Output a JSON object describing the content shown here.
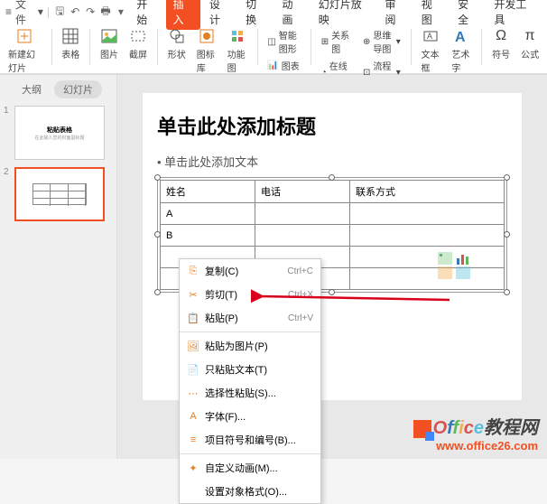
{
  "menu": {
    "file": "文件",
    "tabs": [
      "开始",
      "插入",
      "设计",
      "切换",
      "动画",
      "幻灯片放映",
      "审阅",
      "视图",
      "安全",
      "开发工具"
    ],
    "active_tab": "插入"
  },
  "ribbon": {
    "new_slide": "新建幻灯片",
    "table": "表格",
    "image": "图片",
    "screenshot": "截屏",
    "shapes": "形状",
    "icons": "图标库",
    "functions": "功能图",
    "smart_art": "智能图形",
    "chart": "图表",
    "relation": "关系图",
    "online_chart": "在线图表",
    "mindmap": "思维导图",
    "flowchart": "流程图",
    "textbox": "文本框",
    "wordart": "艺术字",
    "symbol": "符号",
    "equation": "公式"
  },
  "side": {
    "outline": "大纲",
    "slides": "幻灯片",
    "thumb1_title": "粘贴表格",
    "thumb1_sub": "在此输入您的封面副标题",
    "thumbs": [
      "1",
      "2"
    ]
  },
  "slide": {
    "title": "单击此处添加标题",
    "bullet": "单击此处添加文本",
    "headers": [
      "姓名",
      "电话",
      "联系方式"
    ],
    "rows": [
      [
        "A",
        "",
        ""
      ],
      [
        "B",
        "",
        ""
      ]
    ]
  },
  "context_menu": [
    {
      "icon": "⎘",
      "label": "复制(C)",
      "shortcut": "Ctrl+C"
    },
    {
      "icon": "✂",
      "label": "剪切(T)",
      "shortcut": "Ctrl+X"
    },
    {
      "icon": "📋",
      "label": "粘贴(P)",
      "shortcut": "Ctrl+V"
    },
    {
      "sep": true
    },
    {
      "icon": "🖼",
      "label": "粘贴为图片(P)",
      "shortcut": ""
    },
    {
      "icon": "📄",
      "label": "只粘贴文本(T)",
      "shortcut": ""
    },
    {
      "icon": "⋯",
      "label": "选择性粘贴(S)...",
      "shortcut": ""
    },
    {
      "icon": "A",
      "label": "字体(F)...",
      "shortcut": ""
    },
    {
      "icon": "≡",
      "label": "项目符号和编号(B)...",
      "shortcut": ""
    },
    {
      "sep": true
    },
    {
      "icon": "✦",
      "label": "自定义动画(M)...",
      "shortcut": ""
    },
    {
      "icon": "",
      "label": "设置对象格式(O)...",
      "shortcut": ""
    }
  ],
  "watermark": {
    "brand": "Office教程网",
    "url": "www.office26.com"
  }
}
